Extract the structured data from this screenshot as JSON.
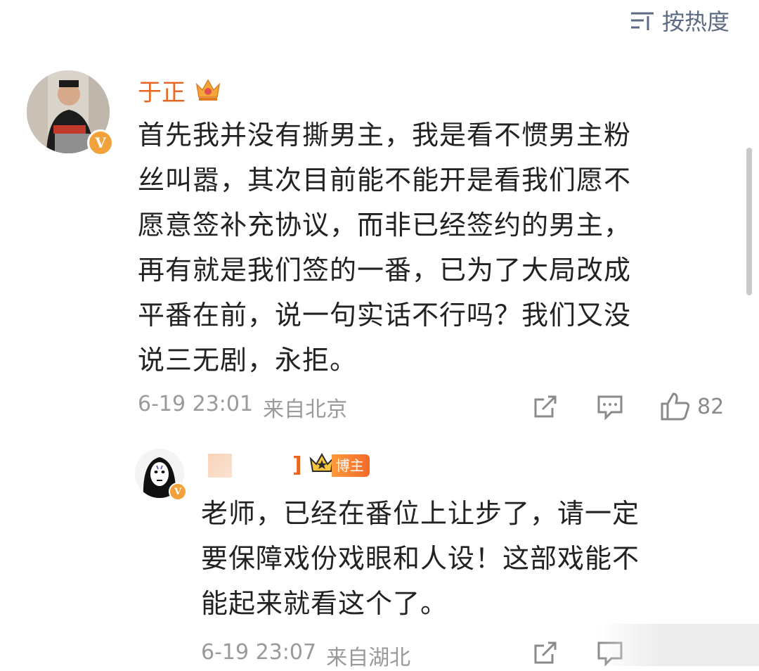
{
  "sort": {
    "label": "按热度"
  },
  "comments": [
    {
      "username": "于正",
      "text_lines": [
        "首先我并没有撕男主，我是看不惯男主粉",
        "丝叫嚣，其次目前能不能开是看我们愿不",
        "愿意签补充协议，而非已经签约的男主，",
        "再有就是我们签的一番，已为了大局改成",
        "平番在前，说一句实话不行吗？我们又没",
        "说三无剧，永拒。"
      ],
      "time": "6-19 23:01",
      "location": "来自北京",
      "likes": "82",
      "badge_letter": "V"
    },
    {
      "username_partial": "]",
      "blogger_label": "博主",
      "text_lines": [
        "老师，已经在番位上让步了，请一定",
        "要保障戏份戏眼和人设！这部戏能不",
        "能起来就看这个了。"
      ],
      "time": "6-19 23:07",
      "location": "来自湖北",
      "badge_letter": "V"
    }
  ],
  "colors": {
    "username": "#e86722",
    "meta": "#9a9a9a",
    "text": "#222222",
    "sort": "#5b6b82",
    "vbadge": "#f2a23a"
  },
  "icons": {
    "sort": "sort-lines-icon",
    "crown": "crown-icon",
    "repost": "repost-icon",
    "reply": "comment-icon",
    "like": "thumbs-up-icon"
  }
}
